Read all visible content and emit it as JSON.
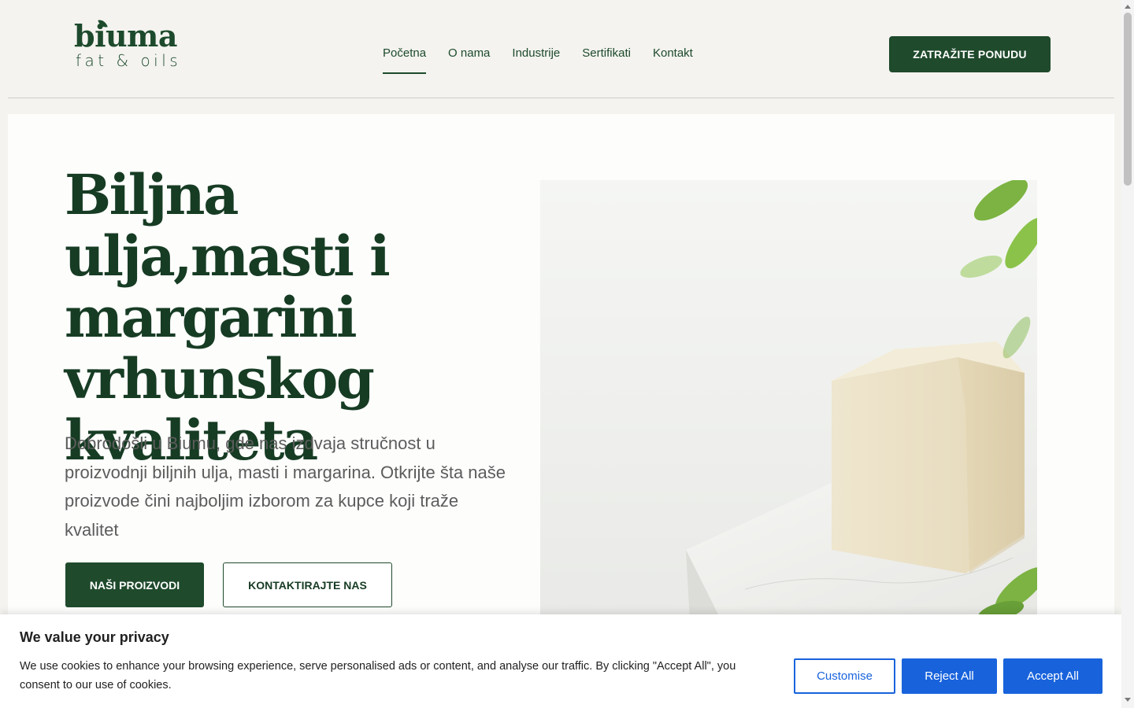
{
  "brand": {
    "name": "biuma",
    "tagline": "fat & oils",
    "color": "#1d4a2c"
  },
  "nav": {
    "items": [
      {
        "label": "Početna",
        "active": true
      },
      {
        "label": "O nama",
        "active": false
      },
      {
        "label": "Industrije",
        "active": false
      },
      {
        "label": "Sertifikati",
        "active": false
      },
      {
        "label": "Kontakt",
        "active": false
      }
    ],
    "cta_label": "ZATRAŽITE PONUDU"
  },
  "hero": {
    "title": "Biljna ulja,masti i margarini vrhunskog kvaliteta",
    "text": "Dobrodošli u Biumu, gde nas izdvaja stručnost u proizvodnji biljnih ulja, masti i margarina. Otkrijte šta naše proizvode čini najboljim izborom za kupce koji traže kvalitet",
    "primary_button": "NAŠI PROIZVODI",
    "secondary_button": "KONTAKTIRAJTE NAS",
    "image_icon": "margarine-block-image"
  },
  "cookie_banner": {
    "title": "We value your privacy",
    "text": "We use cookies to enhance your browsing experience, serve personalised ads or content, and analyse our traffic. By clicking \"Accept All\", you consent to our use of cookies.",
    "customise_label": "Customise",
    "reject_label": "Reject All",
    "accept_label": "Accept All",
    "accent_color": "#1863dc"
  }
}
